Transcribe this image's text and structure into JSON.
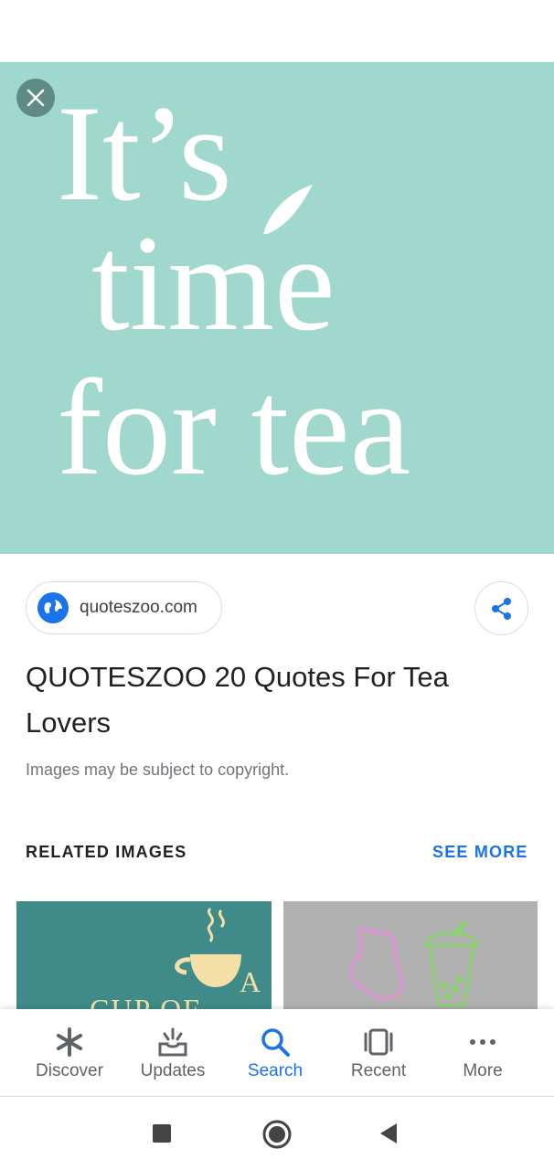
{
  "hero": {
    "image_text_line1": "It’s",
    "image_text_line2": "time",
    "image_text_line3": "for tea",
    "background": "#a0d8ce",
    "close_icon": "close-icon"
  },
  "source": {
    "domain": "quoteszoo.com",
    "icon": "globe-icon"
  },
  "share_icon": "share-icon",
  "result": {
    "title": "QUOTESZOO 20 Quotes For Tea Lovers",
    "copyright_note": "Images may be subject to copyright."
  },
  "related": {
    "label": "RELATED IMAGES",
    "see_more": "SEE MORE",
    "thumb1_text": "A",
    "thumb1_text2": "CUP OF TEA"
  },
  "bottom_nav": {
    "items": [
      {
        "label": "Discover",
        "icon": "asterisk-icon"
      },
      {
        "label": "Updates",
        "icon": "inbox-icon"
      },
      {
        "label": "Search",
        "icon": "search-icon",
        "active": true
      },
      {
        "label": "Recent",
        "icon": "tabs-icon"
      },
      {
        "label": "More",
        "icon": "more-dots-icon"
      }
    ]
  },
  "colors": {
    "accent": "#1a73e8",
    "hero_bg": "#a0d8ce",
    "text_primary": "#202124",
    "text_secondary": "#70757a"
  }
}
